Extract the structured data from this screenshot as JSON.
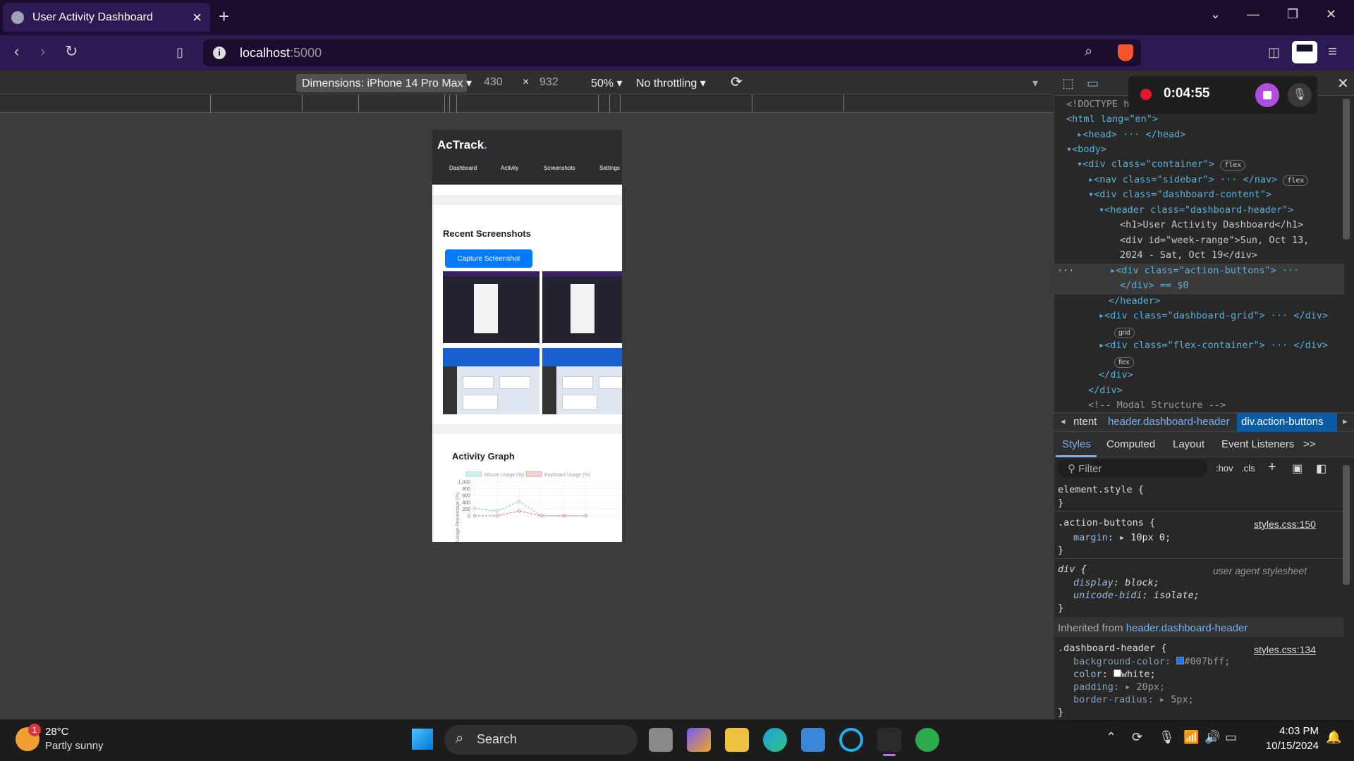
{
  "browser": {
    "tab_title": "User Activity Dashboard",
    "url_host": "localhost",
    "url_port": ":5000"
  },
  "device_toolbar": {
    "dimensions": "Dimensions: iPhone 14 Pro Max",
    "width": "430",
    "times": "×",
    "height": "932",
    "zoom": "50%",
    "throttling": "No throttling"
  },
  "app": {
    "brand": "AcTrack",
    "brand_dot": ".",
    "nav": [
      "Dashboard",
      "Activity",
      "Screenshots",
      "Settings"
    ],
    "recent_screenshots_title": "Recent Screenshots",
    "capture_button": "Capture Screenshot",
    "activity_graph_title": "Activity Graph"
  },
  "chart_data": {
    "type": "line",
    "title": "",
    "ylabel": "Usage Percentage (%)",
    "ylim": [
      0,
      1000
    ],
    "yticks": [
      "1,000",
      "800",
      "600",
      "400",
      "200",
      "0"
    ],
    "series": [
      {
        "name": "Mouse Usage (%)",
        "color": "#76c7c7",
        "values": [
          220,
          140,
          420,
          0,
          0,
          0
        ]
      },
      {
        "name": "Keyboard Usage (%)",
        "color": "#e06a6a",
        "values": [
          0,
          0,
          140,
          0,
          0,
          0
        ]
      }
    ]
  },
  "recording": {
    "time": "0:04:55"
  },
  "devtools": {
    "breadcrumbs": [
      "ntent",
      "header.dashboard-header",
      "div.action-buttons"
    ],
    "tabs": [
      "Styles",
      "Computed",
      "Layout",
      "Event Listeners",
      ">>"
    ],
    "filter_placeholder": "Filter",
    "hov": ":hov",
    "cls": ".cls",
    "elements_lines": [
      "<!DOCTYPE h",
      "<html lang=\"en\">",
      "<head> ··· </head>",
      "<body>",
      "<div class=\"container\">",
      "<nav class=\"sidebar\"> ··· </nav>",
      "<div class=\"dashboard-content\">",
      "<header class=\"dashboard-header\">",
      "<h1>User Activity Dashboard</h1>",
      "<div id=\"week-range\">Sun, Oct 13,",
      "2024 - Sat, Oct 19</div>",
      "<div class=\"action-buttons\"> ···",
      "</div> == $0",
      "</header>",
      "<div class=\"dashboard-grid\"> ··· </div>",
      "<div class=\"flex-container\"> ··· </div>",
      "</div>",
      "</div>",
      "<!-- Modal Structure -->"
    ],
    "badges": [
      "flex",
      "flex",
      "grid",
      "flex"
    ],
    "styles": {
      "element_style": "element.style {",
      "close": "}",
      "action_selector": ".action-buttons {",
      "action_source": "styles.css:150",
      "action_prop": "margin",
      "action_value": "10px 0;",
      "div_selector": "div {",
      "div_source": "user agent stylesheet",
      "div_display": "display",
      "div_display_val": "block;",
      "div_bidi": "unicode-bidi",
      "div_bidi_val": "isolate;",
      "inherited_label": "Inherited from",
      "inherited_link": "header.dashboard-header",
      "header_selector": ".dashboard-header {",
      "header_source": "styles.css:134",
      "bg_prop": "background-color",
      "bg_val": "#007bff;",
      "color_prop": "color",
      "color_val": "white;",
      "padding_prop": "padding",
      "padding_val": "20px;",
      "radius_prop": "border-radius",
      "radius_val": "5px;"
    }
  },
  "taskbar": {
    "weather_temp": "28°C",
    "weather_desc": "Partly sunny",
    "weather_badge": "1",
    "search": "Search",
    "time": "4:03 PM",
    "date": "10/15/2024"
  }
}
